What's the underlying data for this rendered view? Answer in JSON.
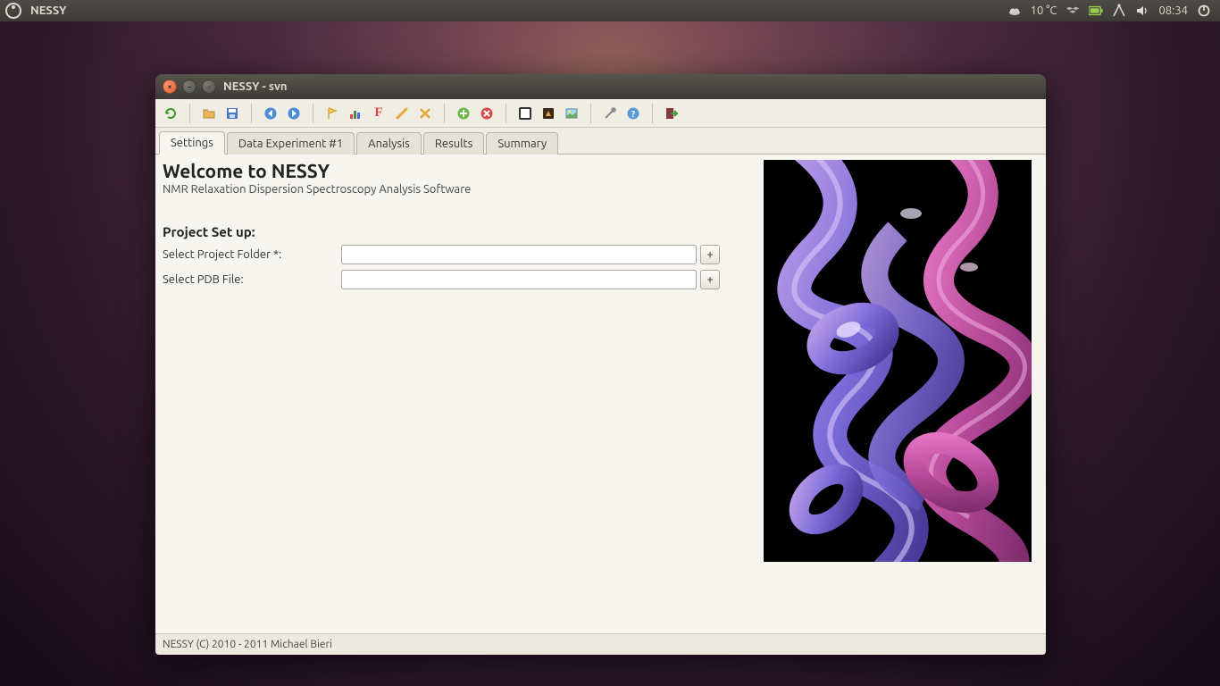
{
  "system": {
    "app_name": "NESSY",
    "temperature": "10 °C",
    "time": "08:34"
  },
  "window": {
    "title": "NESSY - svn"
  },
  "tabs": [
    {
      "label": "Settings",
      "active": true
    },
    {
      "label": "Data Experiment #1",
      "active": false
    },
    {
      "label": "Analysis",
      "active": false
    },
    {
      "label": "Results",
      "active": false
    },
    {
      "label": "Summary",
      "active": false
    }
  ],
  "welcome": {
    "heading": "Welcome to NESSY",
    "subtitle": "NMR Relaxation Dispersion Spectroscopy Analysis Software"
  },
  "project_setup": {
    "heading": "Project Set up:",
    "fields": [
      {
        "label": "Select Project Folder *:",
        "value": "",
        "browse": "+"
      },
      {
        "label": "Select PDB File:",
        "value": "",
        "browse": "+"
      }
    ]
  },
  "statusbar": "NESSY (C) 2010 - 2011 Michael Bieri"
}
